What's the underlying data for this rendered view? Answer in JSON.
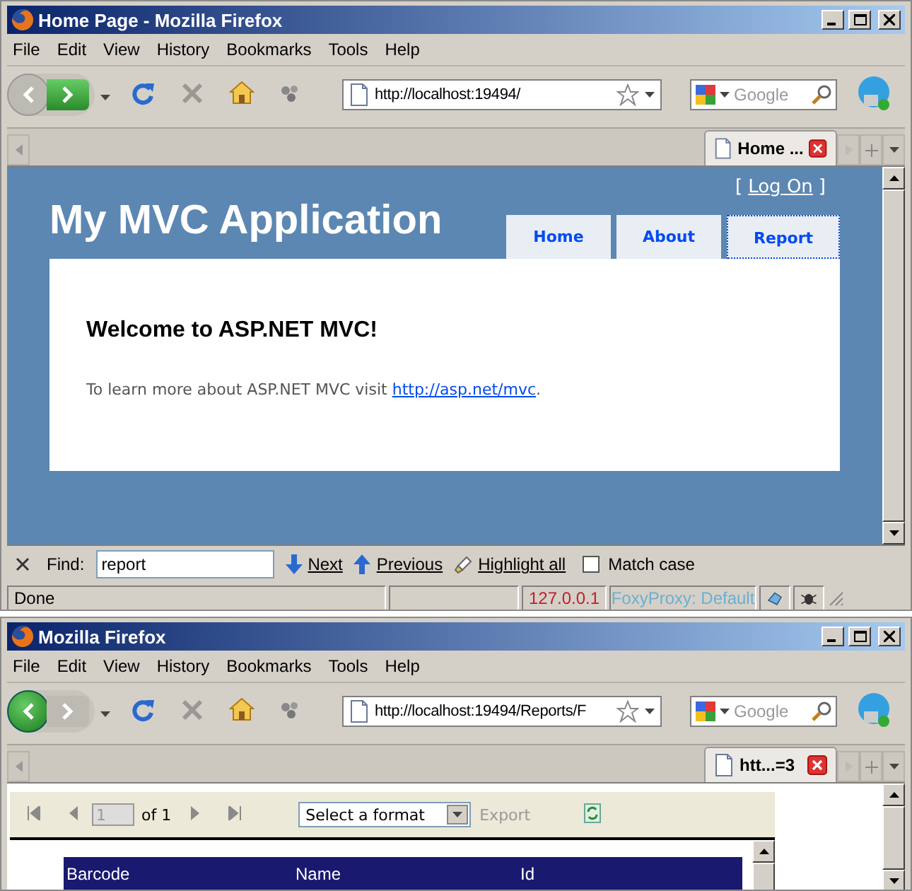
{
  "windows": [
    {
      "title": "Home Page - Mozilla Firefox",
      "menu": [
        "File",
        "Edit",
        "View",
        "History",
        "Bookmarks",
        "Tools",
        "Help"
      ],
      "back_enabled": false,
      "forward_enabled": true,
      "url": "http://localhost:19494/",
      "search_placeholder": "Google",
      "tabs": [
        {
          "label": "Home ...",
          "selected": true
        }
      ],
      "page": {
        "kind": "mvc_site",
        "login_open": "[",
        "login_link": "Log On",
        "login_close": "]",
        "site_title": "My MVC Application",
        "nav": [
          {
            "label": "Home",
            "selected": false
          },
          {
            "label": "About",
            "selected": false
          },
          {
            "label": "Report",
            "selected": true
          }
        ],
        "heading": "Welcome to ASP.NET MVC!",
        "text": "To learn more about ASP.NET MVC visit ",
        "link": "http://asp.net/mvc",
        "text_end": "."
      },
      "find_bar": {
        "label": "Find:",
        "value": "report",
        "next": "Next",
        "previous": "Previous",
        "highlight": "Highlight all",
        "match_case": {
          "label": "Match case",
          "checked": false
        }
      },
      "status_bar": {
        "text": "Done",
        "ip": "127.0.0.1",
        "proxy": "FoxyProxy: Default"
      }
    },
    {
      "title": "Mozilla Firefox",
      "menu": [
        "File",
        "Edit",
        "View",
        "History",
        "Bookmarks",
        "Tools",
        "Help"
      ],
      "back_enabled": true,
      "forward_enabled": false,
      "url": "http://localhost:19494/Reports/F",
      "search_placeholder": "Google",
      "tabs": [
        {
          "label": "htt...=3",
          "selected": true
        }
      ],
      "page": {
        "kind": "report_viewer",
        "page_number": "1",
        "page_count": "of 1",
        "format": "Select a format",
        "export": "Export",
        "export_enabled": false,
        "columns": [
          "Barcode",
          "Name",
          "Id"
        ]
      }
    }
  ]
}
